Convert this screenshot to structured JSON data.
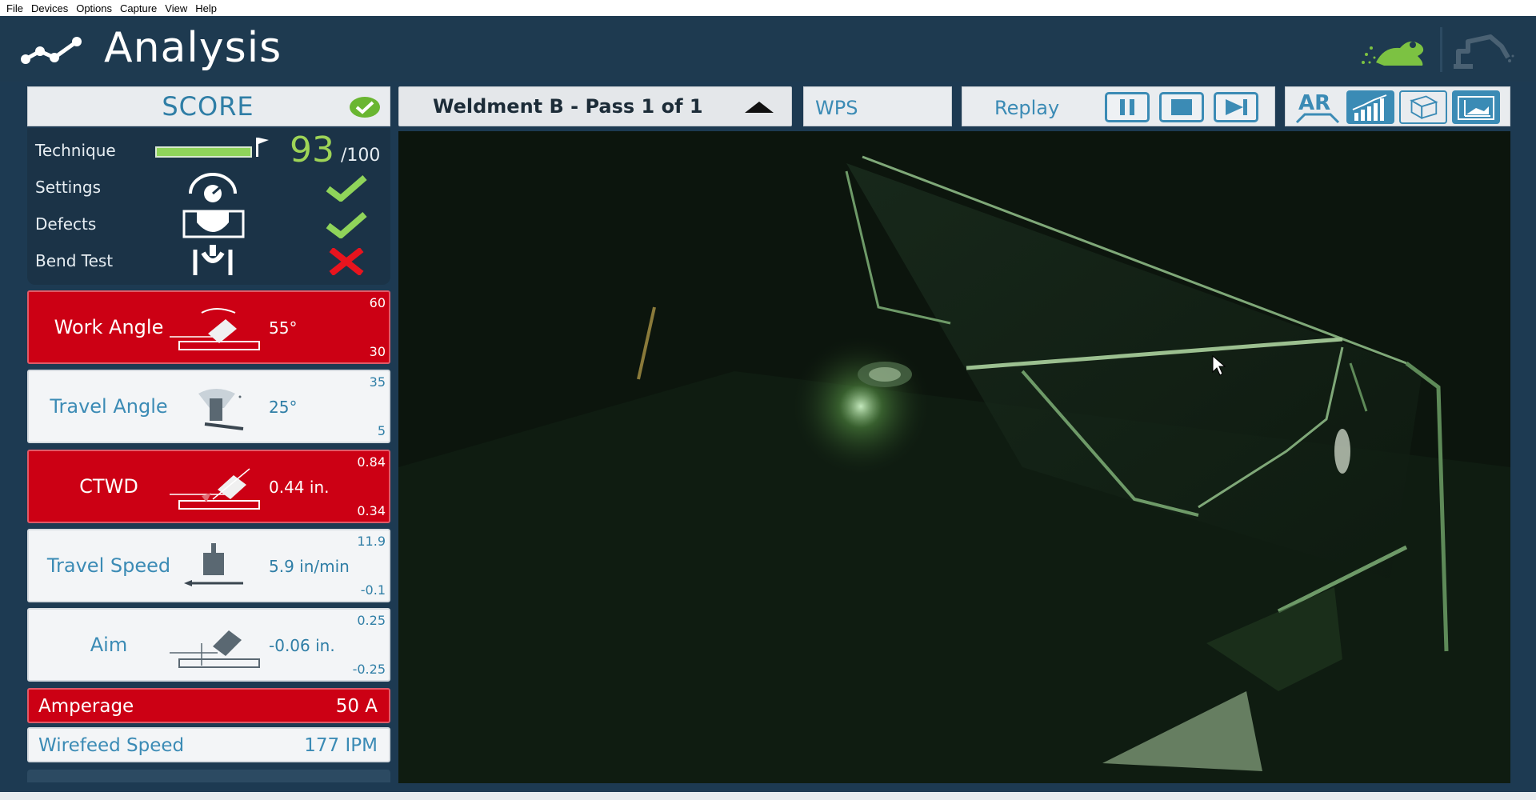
{
  "menu": [
    "File",
    "Devices",
    "Options",
    "Capture",
    "View",
    "Help"
  ],
  "header": {
    "title": "Analysis",
    "logo_icon": "analysis-graph-icon",
    "right_icons": [
      "frog-icon",
      "robot-arm-icon"
    ]
  },
  "score": {
    "title": "SCORE",
    "status_icon": "check-circle-icon",
    "technique": {
      "label": "Technique",
      "score": "93",
      "max": "/100",
      "fill_fraction": 0.93
    },
    "rows": [
      {
        "label": "Settings",
        "icon": "gauge-dial-icon",
        "status": "pass"
      },
      {
        "label": "Defects",
        "icon": "shield-defect-icon",
        "status": "pass"
      },
      {
        "label": "Bend Test",
        "icon": "bend-test-icon",
        "status": "fail"
      }
    ]
  },
  "metrics": [
    {
      "label": "Work Angle",
      "value": "55°",
      "high": "60",
      "low": "30",
      "state": "out-of-range",
      "icon": "work-angle-icon"
    },
    {
      "label": "Travel Angle",
      "value": "25°",
      "high": "35",
      "low": "5",
      "state": "in-range",
      "icon": "travel-angle-icon"
    },
    {
      "label": "CTWD",
      "value": "0.44 in.",
      "high": "0.84",
      "low": "0.34",
      "state": "out-of-range",
      "icon": "ctwd-icon"
    },
    {
      "label": "Travel Speed",
      "value": "5.9 in/min",
      "high": "11.9",
      "low": "-0.1",
      "state": "in-range",
      "icon": "travel-speed-icon"
    },
    {
      "label": "Aim",
      "value": "-0.06 in.",
      "high": "0.25",
      "low": "-0.25",
      "state": "in-range",
      "icon": "aim-icon"
    }
  ],
  "settings": [
    {
      "label": "Amperage",
      "value": "50 A",
      "state": "out-of-range"
    },
    {
      "label": "Wirefeed Speed",
      "value": "177 IPM",
      "state": "in-range"
    }
  ],
  "toolbar": {
    "weldment": "Weldment B - Pass 1 of 1",
    "wps_label": "WPS",
    "replay_label": "Replay",
    "controls": [
      "pause-icon",
      "stop-icon",
      "step-forward-icon"
    ],
    "views": [
      {
        "name": "ar-view-icon",
        "text": "AR"
      },
      {
        "name": "graph-view-icon"
      },
      {
        "name": "3d-view-icon"
      },
      {
        "name": "section-view-icon"
      }
    ]
  },
  "colors": {
    "fail_red": "#cc0014",
    "pass_green": "#8fd45a",
    "accent_blue": "#3b8bb5",
    "header_bg": "#1e3a50"
  }
}
